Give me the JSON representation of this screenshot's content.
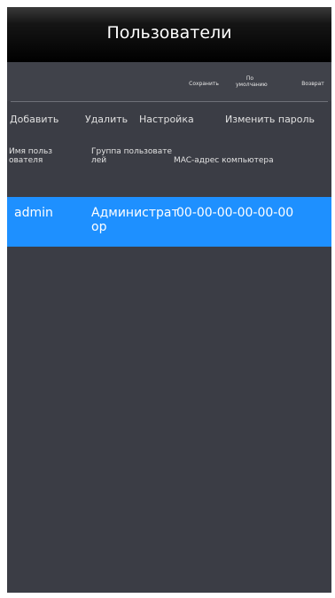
{
  "app": {
    "title": "Пользователи"
  },
  "toolbar": {
    "save": "Сохранить",
    "default": "По умолчанию",
    "back": "Возврат"
  },
  "actions": {
    "add": "Добавить",
    "delete": "Удалить",
    "settings": "Настройка",
    "change_password": "Изменить пароль"
  },
  "table": {
    "headers": [
      "Имя пользователя",
      "Группа пользователей",
      "MAC-адрес компьютера"
    ],
    "rows": [
      {
        "username": "admin",
        "group": "Администратор",
        "mac": "00-00-00-00-00-00"
      }
    ]
  },
  "colors": {
    "selected_row": "#1e90ff",
    "background": "#3b3d45",
    "titlebar": "#000000"
  }
}
